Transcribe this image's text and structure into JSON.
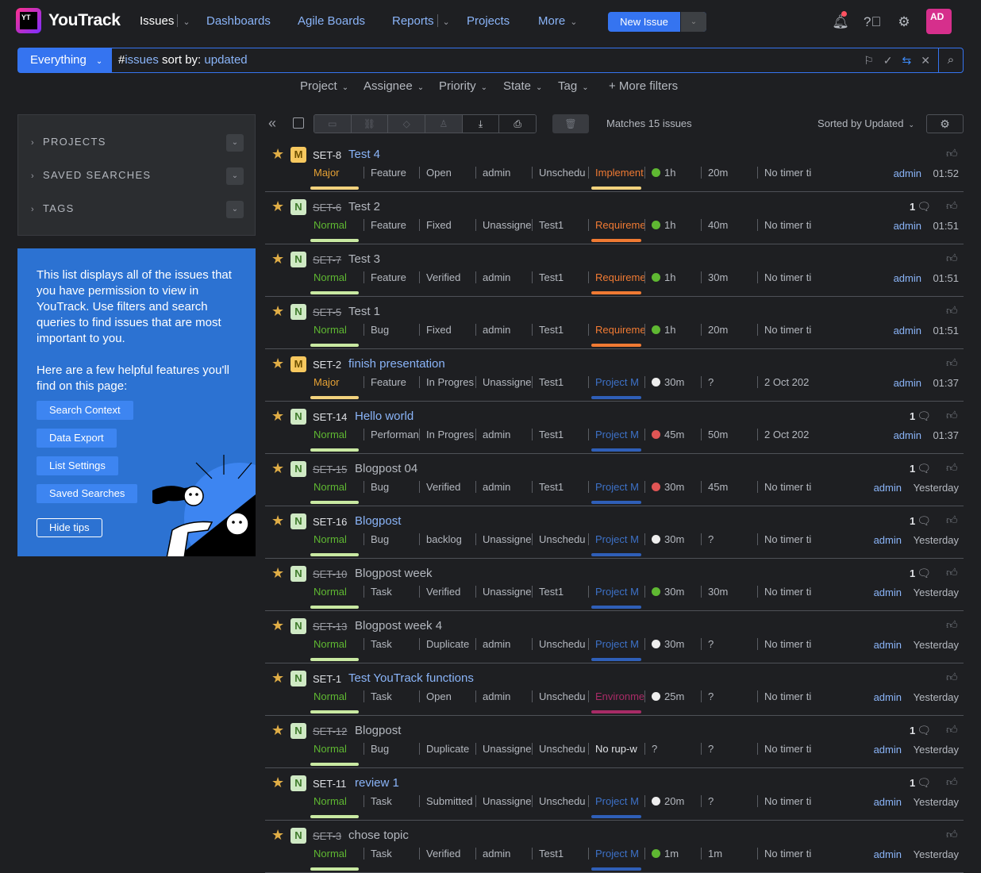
{
  "app": {
    "logo_mark": "YT",
    "name": "YouTrack"
  },
  "nav": {
    "issues": "Issues",
    "dashboards": "Dashboards",
    "agile": "Agile Boards",
    "reports": "Reports",
    "projects": "Projects",
    "more": "More",
    "new_issue": "New Issue",
    "avatar": "AD"
  },
  "search": {
    "context": "Everything",
    "query_hash": "#",
    "query_issues": "issues",
    "query_sort": " sort by: ",
    "query_updated": "updated"
  },
  "filters": {
    "project": "Project",
    "assignee": "Assignee",
    "priority": "Priority",
    "state": "State",
    "tag": "Tag",
    "more": "+  More filters"
  },
  "sidebar": {
    "projects": "PROJECTS",
    "saved": "SAVED SEARCHES",
    "tags": "TAGS"
  },
  "tips": {
    "p1": "This list displays all of the issues that you have permission to view in YouTrack. Use filters and search queries to find issues that are most important to you.",
    "p2": "Here are a few helpful features you'll find on this page:",
    "b1": "Search Context",
    "b2": "Data Export",
    "b3": "List Settings",
    "b4": "Saved Searches",
    "hide": "Hide tips"
  },
  "toolbar": {
    "matches": "Matches 15 issues",
    "sorted": "Sorted by Updated"
  },
  "issues": [
    {
      "p": "M",
      "id": "SET-8",
      "res": false,
      "title": "Test 4",
      "prio": "Major",
      "type": "Feature",
      "state": "Open",
      "assignee": "admin",
      "sprint": "Unschedu",
      "tag": "Implement",
      "tagc": "orange",
      "dot": "#5fb832",
      "est": "1h",
      "spent": "20m",
      "timer": "No timer ti",
      "comments": "",
      "who": "admin",
      "when": "01:52"
    },
    {
      "p": "N",
      "id": "SET-6",
      "res": true,
      "title": "Test 2",
      "prio": "Normal",
      "type": "Feature",
      "state": "Fixed",
      "assignee": "Unassigne",
      "sprint": "Test1",
      "tag": "Requireme",
      "tagc": "orange",
      "dot": "#5fb832",
      "est": "1h",
      "spent": "40m",
      "timer": "No timer ti",
      "comments": "1",
      "who": "admin",
      "when": "01:51"
    },
    {
      "p": "N",
      "id": "SET-7",
      "res": true,
      "title": "Test 3",
      "prio": "Normal",
      "type": "Feature",
      "state": "Verified",
      "assignee": "admin",
      "sprint": "Test1",
      "tag": "Requireme",
      "tagc": "orange",
      "dot": "#5fb832",
      "est": "1h",
      "spent": "30m",
      "timer": "No timer ti",
      "comments": "",
      "who": "admin",
      "when": "01:51"
    },
    {
      "p": "N",
      "id": "SET-5",
      "res": true,
      "title": "Test 1",
      "prio": "Normal",
      "type": "Bug",
      "state": "Fixed",
      "assignee": "admin",
      "sprint": "Test1",
      "tag": "Requireme",
      "tagc": "orange",
      "dot": "#5fb832",
      "est": "1h",
      "spent": "20m",
      "timer": "No timer ti",
      "comments": "",
      "who": "admin",
      "when": "01:51"
    },
    {
      "p": "M",
      "id": "SET-2",
      "res": false,
      "title": "finish presentation",
      "prio": "Major",
      "type": "Feature",
      "state": "In Progres",
      "assignee": "Unassigne",
      "sprint": "Test1",
      "tag": "Project M",
      "tagc": "blue",
      "dot": "#eeeeee",
      "est": "30m",
      "spent": "?",
      "timer": "2 Oct 202",
      "comments": "",
      "who": "admin",
      "when": "01:37"
    },
    {
      "p": "N",
      "id": "SET-14",
      "res": false,
      "title": "Hello world",
      "prio": "Normal",
      "type": "Performan",
      "state": "In Progres",
      "assignee": "admin",
      "sprint": "Test1",
      "tag": "Project M",
      "tagc": "blue",
      "dot": "#e05555",
      "est": "45m",
      "spent": "50m",
      "timer": "2 Oct 202",
      "comments": "1",
      "who": "admin",
      "when": "01:37"
    },
    {
      "p": "N",
      "id": "SET-15",
      "res": true,
      "title": "Blogpost 04",
      "prio": "Normal",
      "type": "Bug",
      "state": "Verified",
      "assignee": "admin",
      "sprint": "Test1",
      "tag": "Project M",
      "tagc": "blue",
      "dot": "#e05555",
      "est": "30m",
      "spent": "45m",
      "timer": "No timer ti",
      "comments": "1",
      "who": "admin",
      "when": "Yesterday"
    },
    {
      "p": "N",
      "id": "SET-16",
      "res": false,
      "title": "Blogpost",
      "prio": "Normal",
      "type": "Bug",
      "state": "backlog",
      "assignee": "Unassigne",
      "sprint": "Unschedu",
      "tag": "Project M",
      "tagc": "blue",
      "dot": "#eeeeee",
      "est": "30m",
      "spent": "?",
      "timer": "No timer ti",
      "comments": "1",
      "who": "admin",
      "when": "Yesterday"
    },
    {
      "p": "N",
      "id": "SET-10",
      "res": true,
      "title": "Blogpost week",
      "prio": "Normal",
      "type": "Task",
      "state": "Verified",
      "assignee": "Unassigne",
      "sprint": "Test1",
      "tag": "Project M",
      "tagc": "blue",
      "dot": "#5fb832",
      "est": "30m",
      "spent": "30m",
      "timer": "No timer ti",
      "comments": "1",
      "who": "admin",
      "when": "Yesterday"
    },
    {
      "p": "N",
      "id": "SET-13",
      "res": true,
      "title": "Blogpost week 4",
      "prio": "Normal",
      "type": "Task",
      "state": "Duplicate",
      "assignee": "admin",
      "sprint": "Unschedu",
      "tag": "Project M",
      "tagc": "blue",
      "dot": "#eeeeee",
      "est": "30m",
      "spent": "?",
      "timer": "No timer ti",
      "comments": "",
      "who": "admin",
      "when": "Yesterday"
    },
    {
      "p": "N",
      "id": "SET-1",
      "res": false,
      "title": "Test YouTrack functions",
      "prio": "Normal",
      "type": "Task",
      "state": "Open",
      "assignee": "admin",
      "sprint": "Unschedu",
      "tag": "Environme",
      "tagc": "mag",
      "dot": "#eeeeee",
      "est": "25m",
      "spent": "?",
      "timer": "No timer ti",
      "comments": "",
      "who": "admin",
      "when": "Yesterday"
    },
    {
      "p": "N",
      "id": "SET-12",
      "res": true,
      "title": "Blogpost",
      "prio": "Normal",
      "type": "Bug",
      "state": "Duplicate",
      "assignee": "Unassigne",
      "sprint": "Unschedu",
      "tag": "No rup-w",
      "tagc": "white",
      "dot": "",
      "est": "?",
      "spent": "?",
      "timer": "No timer ti",
      "comments": "1",
      "who": "admin",
      "when": "Yesterday"
    },
    {
      "p": "N",
      "id": "SET-11",
      "res": false,
      "title": "review 1",
      "prio": "Normal",
      "type": "Task",
      "state": "Submitted",
      "assignee": "Unassigne",
      "sprint": "Unschedu",
      "tag": "Project M",
      "tagc": "blue",
      "dot": "#eeeeee",
      "est": "20m",
      "spent": "?",
      "timer": "No timer ti",
      "comments": "1",
      "who": "admin",
      "when": "Yesterday"
    },
    {
      "p": "N",
      "id": "SET-3",
      "res": true,
      "title": "chose topic",
      "prio": "Normal",
      "type": "Task",
      "state": "Verified",
      "assignee": "admin",
      "sprint": "Test1",
      "tag": "Project M",
      "tagc": "blue",
      "dot": "#5fb832",
      "est": "1m",
      "spent": "1m",
      "timer": "No timer ti",
      "comments": "",
      "who": "admin",
      "when": "Yesterday"
    }
  ],
  "colors": {
    "accent": "#3574f0",
    "major": "#e5a134",
    "normal": "#5fb832",
    "link": "#8ab4f8"
  }
}
